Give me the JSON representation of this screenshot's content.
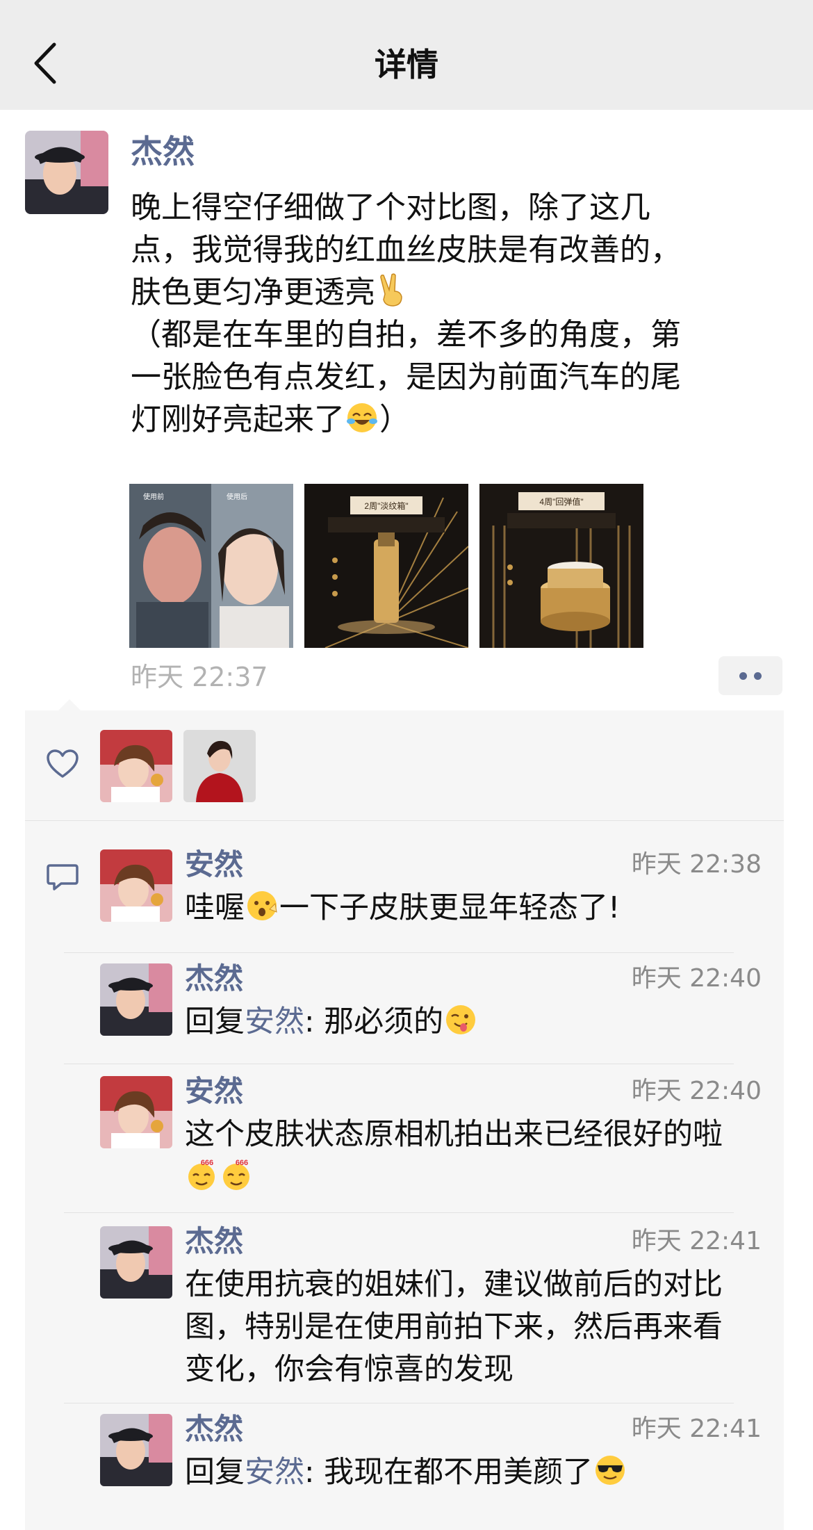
{
  "nav": {
    "back_icon": "chevron-left-icon",
    "title": "详情"
  },
  "post": {
    "author": "杰然",
    "text_lines": [
      "晚上得空仔细做了个对比图，除了这几",
      "点，我觉得我的红血丝皮肤是有改善的，",
      "肤色更匀净更透亮",
      "（都是在车里的自拍，差不多的角度，第",
      "一张脸色有点发红，是因为前面汽车的尾",
      "灯刚好亮起来了",
      "）"
    ],
    "emoji_1": "victory-hand-emoji",
    "emoji_2": "laughing-tears-emoji",
    "images": {
      "image_1_label_left": "使用前",
      "image_1_label_right": "使用后",
      "image_2_heading": "2周\"淡纹箱\"",
      "image_3_heading": "4周\"回弹值\""
    },
    "time": "昨天 22:37"
  },
  "likes": {
    "icon": "heart-outline-icon",
    "count": 2
  },
  "comments": {
    "icon": "comment-bubble-icon",
    "items": [
      {
        "name": "安然",
        "time": "昨天 22:38",
        "text": "哇喔",
        "text_after": "一下子皮肤更显年轻态了!",
        "emoji": "surprised-face-emoji"
      },
      {
        "name": "杰然",
        "time": "昨天 22:40",
        "reply_prefix": "回复",
        "reply_to": "安然",
        "text": ": 那必须的",
        "emoji": "winking-tongue-emoji"
      },
      {
        "name": "安然",
        "time": "昨天 22:40",
        "text": "这个皮肤状态原相机拍出来已经很好的啦",
        "emoji": "666-emoji",
        "emoji_label": "666"
      },
      {
        "name": "杰然",
        "time": "昨天 22:41",
        "text_lines": [
          "在使用抗衰的姐妹们，建议做前后的对比",
          "图，特别是在使用前拍下来，然后再来看",
          "变化，你会有惊喜的发现"
        ]
      },
      {
        "name": "杰然",
        "time": "昨天 22:41",
        "reply_prefix": "回复",
        "reply_to": "安然",
        "text": ": 我现在都不用美颜了",
        "emoji": "sunglasses-face-emoji"
      }
    ]
  },
  "colors": {
    "nav_bg": "#ededed",
    "name_color": "#5b6a91",
    "comment_bg": "#f6f6f6",
    "time_color": "#b2b2b2"
  }
}
